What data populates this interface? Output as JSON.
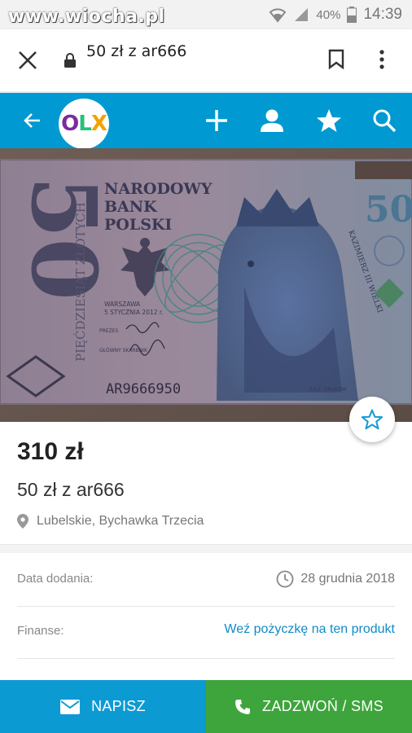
{
  "statusbar": {
    "watermark": "www.wiocha.pl",
    "battery": "40%",
    "time": "14:39"
  },
  "browser": {
    "page_title": "50 zł z ar666"
  },
  "olx": {
    "logo_o": "O",
    "logo_l": "L",
    "logo_x": "X"
  },
  "banknote": {
    "denomination": "50",
    "bank_line1": "NARODOWY",
    "bank_line2": "BANK",
    "bank_line3": "POLSKI",
    "side_text": "PIĘĆDZIESIĄT ZŁOTYCH",
    "serial": "AR9666950",
    "place_date_1": "WARSZAWA",
    "place_date_2": "5 STYCZNIA 2012 r.",
    "sig1": "PREZES",
    "sig2": "GŁÓWNY SKARBNIK",
    "king": "KAZIMIERZ III WIELKI",
    "printer": "P.A.E. DRUKÓW"
  },
  "listing": {
    "price": "310 zł",
    "title": "50 zł z ar666",
    "location": "Lubelskie, Bychawka Trzecia"
  },
  "details": {
    "date_label": "Data dodania:",
    "date_value": "28 grudnia 2018",
    "finance_label": "Finanse:",
    "finance_link": "Weź pożyczkę na ten produkt"
  },
  "actions": {
    "message": "NAPISZ",
    "call": "ZADZWOŃ / SMS"
  },
  "colors": {
    "olx_blue": "#0099d1",
    "message_btn": "#0c9ad3",
    "call_btn": "#3ea53c",
    "link": "#0f8bc7"
  }
}
